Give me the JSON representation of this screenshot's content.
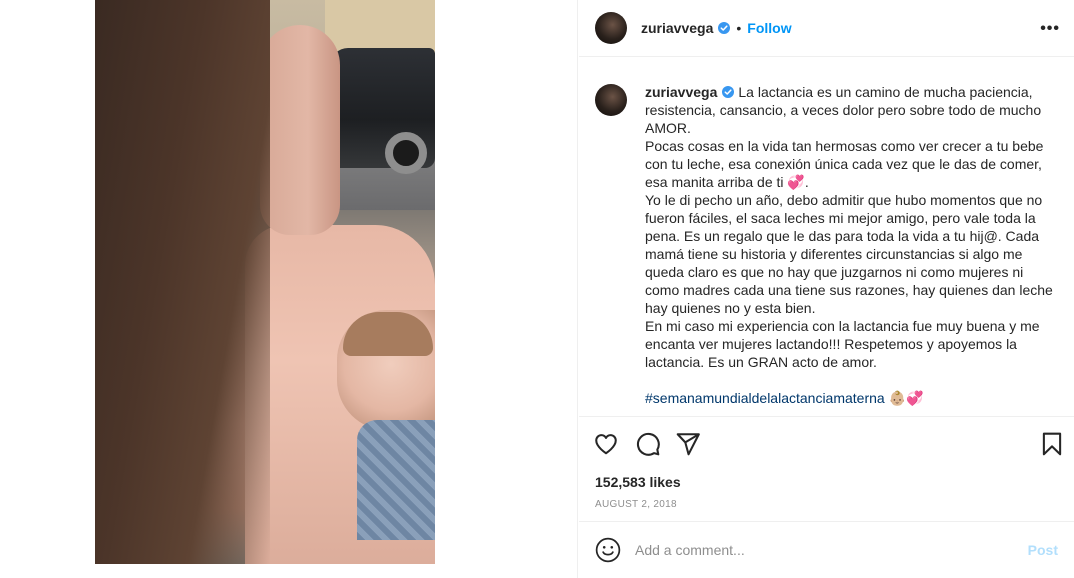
{
  "post": {
    "username": "zuriavvega",
    "follow_label": "Follow",
    "separator": "•",
    "more_label": "•••"
  },
  "caption": {
    "username": "zuriavvega",
    "lines": [
      "La lactancia es un camino de mucha paciencia,",
      "resistencia, cansancio, a veces dolor pero sobre todo de mucho",
      "AMOR.",
      "Pocas cosas en la vida tan hermosas como ver crecer a tu bebe",
      "con tu leche, esa conexión única cada vez que le das de comer,",
      "esa manita arriba de ti 💞.",
      "Yo le di pecho un año, debo admitir que hubo momentos que no",
      "fueron fáciles, el saca leches mi mejor amigo, pero vale toda la",
      "pena. Es un regalo que le das para toda la vida a tu hij@. Cada",
      "mamá tiene su historia y diferentes circunstancias si algo me",
      "queda claro es que no hay que juzgarnos ni como mujeres ni",
      "como madres cada una tiene sus razones, hay quienes dan leche",
      "hay quienes no y esta bien.",
      "En mi caso mi experiencia con la lactancia fue muy buena y me",
      "encanta ver mujeres lactando!!! Respetemos y apoyemos la",
      "lactancia. Es un GRAN acto de amor."
    ],
    "hashtag": "#semanamundialdelalactanciamaterna",
    "hashtag_suffix": " 👶🏼💞"
  },
  "stats": {
    "likes": "152,583 likes",
    "date": "AUGUST 2, 2018"
  },
  "comment": {
    "placeholder": "Add a comment...",
    "post_label": "Post"
  },
  "icons": {
    "verified": "verified-badge-icon",
    "like": "heart-icon",
    "comment": "comment-bubble-icon",
    "share": "paper-plane-icon",
    "save": "bookmark-icon",
    "emoji": "smiley-icon",
    "more": "more-dots-icon"
  },
  "colors": {
    "accent": "#0095f6",
    "hashtag": "#00376b",
    "muted": "#8e8e8e",
    "post_disabled": "#b2dffc",
    "verified": "#3897f0"
  }
}
